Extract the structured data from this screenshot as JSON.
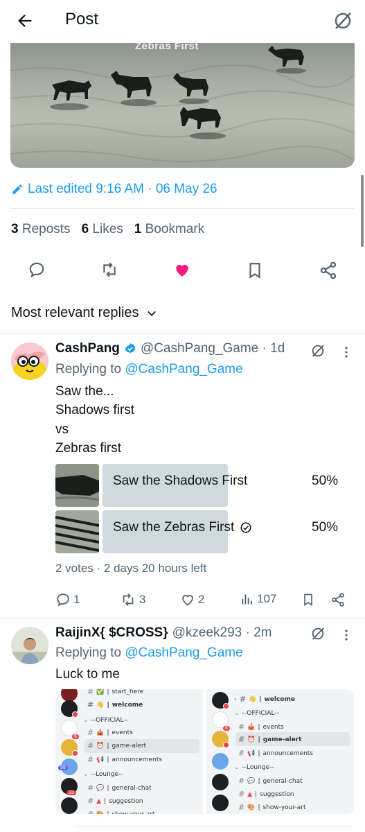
{
  "header": {
    "title": "Post",
    "back_icon": "arrow-left-icon",
    "grok_icon": "grok-icon"
  },
  "post": {
    "media_watermark": "Zebras First",
    "edited_text": "Last edited 9:16 AM · 06 May 26",
    "stats": {
      "reposts_count": "3",
      "reposts_label": "Reposts",
      "likes_count": "6",
      "likes_label": "Likes",
      "bookmarks_count": "1",
      "bookmarks_label": "Bookmark"
    },
    "accent_color": "#1d9bf0",
    "like_color": "#f91880"
  },
  "replies_sort": {
    "label": "Most relevant replies"
  },
  "reply1": {
    "name": "CashPang",
    "handle": "@CashPang_Game · 1d",
    "replying_prefix": "Replying to ",
    "replying_handle": "@CashPang_Game",
    "lines": [
      "Saw the...",
      "Shadows first",
      "vs",
      "Zebras first"
    ],
    "poll": {
      "options": [
        {
          "label": "Saw the Shadows First",
          "percent": "50%",
          "value": 0.5
        },
        {
          "label": "Saw the Zebras First",
          "percent": "50%",
          "value": 0.5,
          "selected": true
        }
      ],
      "meta": "2 votes · 2 days 20 hours left"
    },
    "actions": {
      "replies": "1",
      "reposts": "3",
      "likes": "2",
      "views": "107"
    }
  },
  "reply2": {
    "name": "RaijinX{ $CROSS}",
    "handle": "@kzeek293 · 2m",
    "replying_prefix": "Replying to ",
    "replying_handle": "@CashPang_Game",
    "text": "Luck to me",
    "left_shot": {
      "top_item": "start_here",
      "welcome": "welcome",
      "section1": "--OFFICIAL--",
      "events": "events",
      "game_alert": "game-alert",
      "announcements": "announcements",
      "section2": "--Lounge--",
      "general_chat": "general-chat",
      "suggestion": "suggestion",
      "show_your_art": "show-your-art"
    },
    "right_shot": {
      "welcome": "welcome",
      "section1": "--OFFICIAL--",
      "events": "events",
      "game_alert": "game-alert",
      "announcements": "announcements",
      "section2": "--Lounge--",
      "general_chat": "general-chat",
      "suggestion": "suggestion",
      "show_your_art": "show-your-art"
    },
    "badges": {
      "b1": "6",
      "b2": "6",
      "b3": "99",
      "b4": "23"
    }
  }
}
